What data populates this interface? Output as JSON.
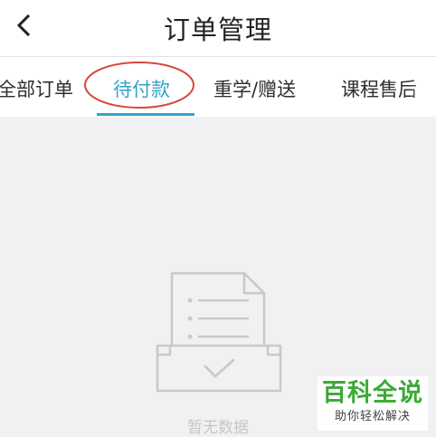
{
  "header": {
    "back_icon": "chevron-left-icon",
    "title": "订单管理"
  },
  "tabs": [
    {
      "label": "全部订单",
      "active": false
    },
    {
      "label": "待付款",
      "active": true
    },
    {
      "label": "重学/赠送",
      "active": false
    },
    {
      "label": "课程售后",
      "active": false
    }
  ],
  "empty_state": {
    "icon": "empty-box-document-icon",
    "text": "暂无数据"
  },
  "watermark": {
    "main": "百科全说",
    "sub": "助你轻松解决"
  },
  "colors": {
    "accent": "#35a3c9",
    "annotation": "#d9463a",
    "background": "#f1f1f3",
    "watermark_green": "#3aaa35"
  }
}
